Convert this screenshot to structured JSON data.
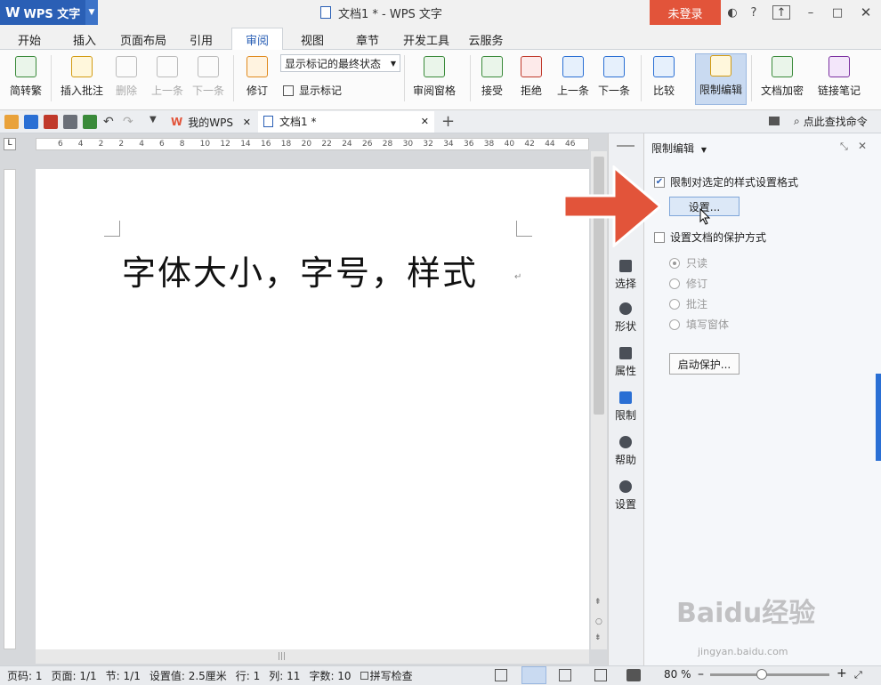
{
  "titlebar": {
    "app_name": "WPS 文字",
    "doc_title": "文档1 * - WPS 文字",
    "login_label": "未登录"
  },
  "menu": {
    "tabs": [
      "开始",
      "插入",
      "页面布局",
      "引用",
      "审阅",
      "视图",
      "章节",
      "开发工具",
      "云服务"
    ],
    "active": "审阅"
  },
  "ribbon": {
    "trad_simplified": "简转繁",
    "insert_comment": "插入批注",
    "delete": "删除",
    "prev": "上一条",
    "next": "下一条",
    "revise": "修订",
    "markup_state": "显示标记的最终状态",
    "show_markup": "显示标记",
    "review_pane": "审阅窗格",
    "accept": "接受",
    "reject": "拒绝",
    "prev2": "上一条",
    "next2": "下一条",
    "compare": "比较",
    "restrict_edit": "限制编辑",
    "doc_encrypt": "文档加密",
    "link_notes": "链接笔记"
  },
  "quickbar": {
    "tab_mywps": "我的WPS",
    "tab_doc": "文档1 *",
    "search_cmd": "点此查找命令"
  },
  "ruler": {
    "ticks": [
      "6",
      "4",
      "2",
      "2",
      "4",
      "6",
      "8",
      "10",
      "12",
      "14",
      "16",
      "18",
      "20",
      "22",
      "24",
      "26",
      "28",
      "30",
      "32",
      "34",
      "36",
      "38",
      "40",
      "42",
      "44",
      "46"
    ]
  },
  "document": {
    "text": "字体大小，字号，样式"
  },
  "side_column": {
    "items": [
      "选择",
      "形状",
      "属性",
      "限制",
      "帮助",
      "设置"
    ]
  },
  "panel": {
    "title": "限制编辑",
    "opt_restrict_format": "限制对选定的样式设置格式",
    "settings_btn": "设置...",
    "opt_protect": "设置文档的保护方式",
    "radios": [
      "只读",
      "修订",
      "批注",
      "填写窗体"
    ],
    "start_btn": "启动保护..."
  },
  "status": {
    "page_code": "页码: 1",
    "pages": "页面: 1/1",
    "section": "节: 1/1",
    "setting": "设置值: 2.5厘米",
    "row": "行: 1",
    "col": "列: 11",
    "words": "字数: 10",
    "spell": "拼写检查",
    "zoom": "80 %"
  },
  "watermark": {
    "text": "Baidu经验",
    "sub": "jingyan.baidu.com"
  },
  "colors": {
    "accent": "#2a5fb5",
    "login": "#e2543a",
    "arrow": "#e2543a"
  }
}
